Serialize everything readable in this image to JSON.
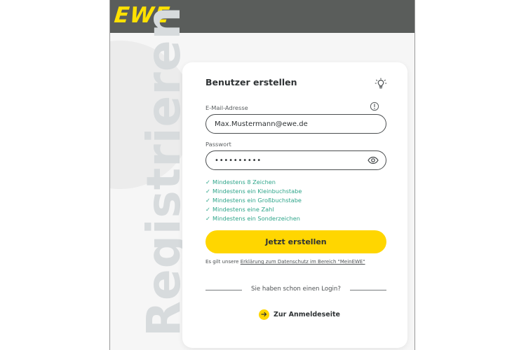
{
  "header": {
    "brand": "EWE"
  },
  "background": {
    "vertical_word": "Registrieren"
  },
  "form": {
    "title": "Benutzer erstellen",
    "email_label": "E-Mail-Adresse",
    "email_value": "Max.Mustermann@ewe.de",
    "password_label": "Passwort",
    "password_value": "••••••••••",
    "password_rules": [
      "Mindestens 8 Zeichen",
      "Mindestens ein Kleinbuchstabe",
      "Mindestens ein Großbuchstabe",
      "Mindestens eine Zahl",
      "Mindestens ein Sonderzeichen"
    ],
    "submit_label": "Jetzt erstellen",
    "privacy_prefix": "Es gilt unsere",
    "privacy_link": "Erklärung zum Datenschutz im Bereich \"MeinEWE\"",
    "separator_text": "Sie haben schon einen Login?",
    "login_link": "Zur Anmeldeseite"
  },
  "colors": {
    "brand_yellow": "#ffd600",
    "header_gray": "#5a5d5b",
    "success_green": "#2ea58a"
  },
  "icons": {
    "hint": "lightbulb-icon",
    "info": "info-icon",
    "password_visibility": "eye-icon",
    "login": "arrow-right-icon"
  }
}
